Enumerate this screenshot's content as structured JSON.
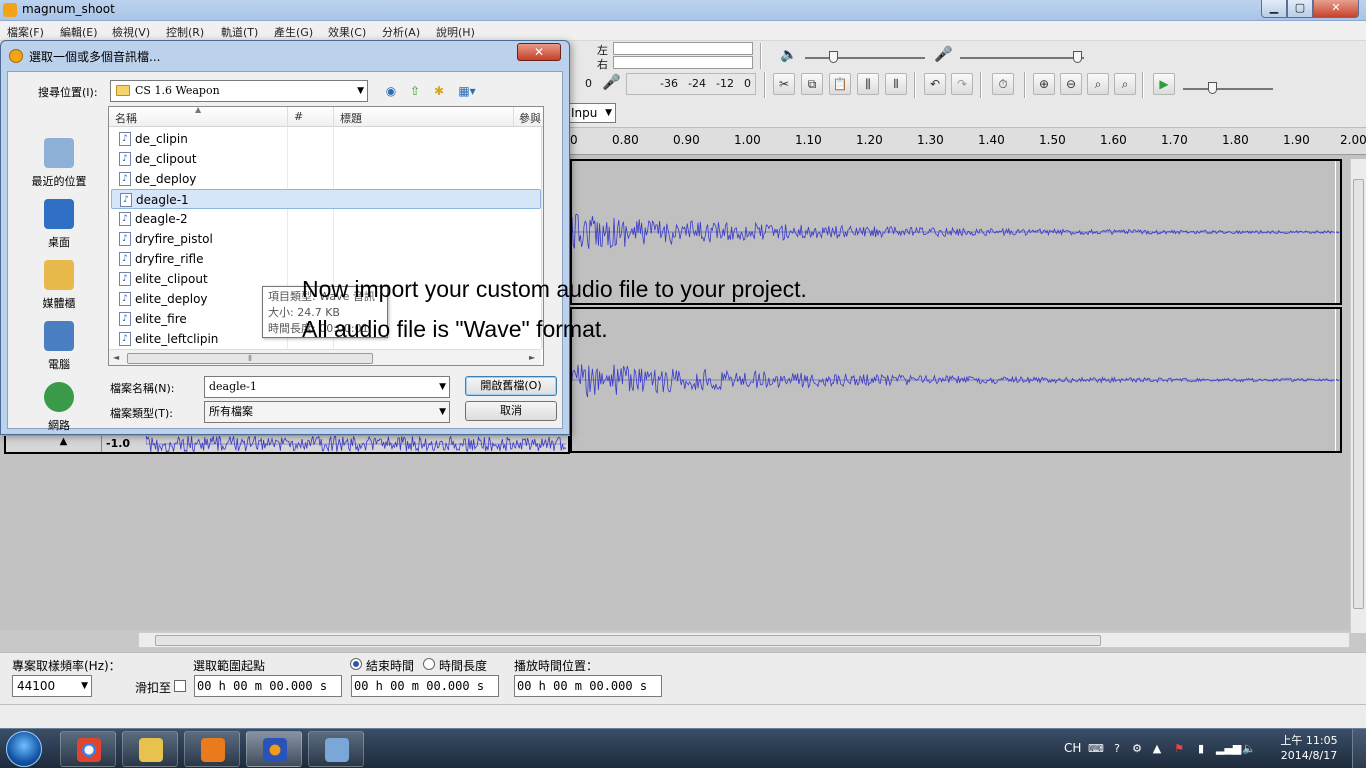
{
  "window": {
    "title": "magnum_shoot",
    "minimize": "▁",
    "maximize": "▢",
    "close": "✕"
  },
  "menu": [
    "檔案(F)",
    "編輯(E)",
    "檢視(V)",
    "控制(R)",
    "軌道(T)",
    "產生(G)",
    "效果(C)",
    "分析(A)",
    "說明(H)"
  ],
  "toolbar": {
    "channel_left": "左",
    "channel_right": "右",
    "meter_ticks": [
      "-36",
      "-24",
      "-12",
      "0"
    ],
    "input_zero": "0",
    "input_combo": "Inpu"
  },
  "ruler": {
    "labels": [
      "0",
      "0.80",
      "0.90",
      "1.00",
      "1.10",
      "1.20",
      "1.30",
      "1.40",
      "1.50",
      "1.60",
      "1.70",
      "1.80",
      "1.90",
      "2.00"
    ]
  },
  "trackpanel": {
    "collapse_arrow": "▲",
    "scale_min": "-1.0"
  },
  "selection_bar": {
    "rate_label": "專案取樣頻率(Hz)：",
    "rate_value": "44100",
    "snap_label": "滑扣至",
    "sel_start_label": "選取範圍起點",
    "end_label": "結束時間",
    "length_label": "時間長度",
    "play_pos_label": "播放時間位置：",
    "time_start": "00 h 00 m 00.000 s",
    "time_end": "00 h 00 m 00.000 s",
    "time_play": "00 h 00 m 00.000 s"
  },
  "dialog": {
    "title": "選取一個或多個音訊檔...",
    "close": "✕",
    "lookin_label": "搜尋位置(I):",
    "lookin_value": "CS 1.6 Weapon",
    "places": [
      {
        "label": "最近的位置",
        "icon": "recent-places-icon",
        "color": "#8fb0d6"
      },
      {
        "label": "桌面",
        "icon": "desktop-icon",
        "color": "#2f6fc4"
      },
      {
        "label": "媒體櫃",
        "icon": "libraries-icon",
        "color": "#e7b94a"
      },
      {
        "label": "電腦",
        "icon": "computer-icon",
        "color": "#4b7fc2"
      },
      {
        "label": "網路",
        "icon": "network-icon",
        "color": "#3b9a4a"
      }
    ],
    "columns": [
      "名稱",
      "#",
      "標題",
      "參與"
    ],
    "files": [
      "de_clipin",
      "de_clipout",
      "de_deploy",
      "deagle-1",
      "deagle-2",
      "dryfire_pistol",
      "dryfire_rifle",
      "elite_clipout",
      "elite_deploy",
      "elite_fire",
      "elite_leftclipin"
    ],
    "selected_index": 3,
    "tooltip": {
      "type": "項目類型: Wave 音訊",
      "size": "大小: 24.7 KB",
      "length": "時間長度: 00:00:01"
    },
    "filename_label": "檔案名稱(N):",
    "filename_value": "deagle-1",
    "filetype_label": "檔案類型(T):",
    "filetype_value": "所有檔案",
    "open_button": "開啟舊檔(O)",
    "cancel_button": "取消"
  },
  "annotation": {
    "line1": "Now import your custom audio file to your project.",
    "line2": "All audio file is \"Wave\" format."
  },
  "taskbar": {
    "lang": "CH",
    "time": "上午 11:05",
    "date": "2014/8/17",
    "apps": [
      {
        "name": "chrome",
        "color": "#e0442c"
      },
      {
        "name": "explorer",
        "color": "#e8c24f"
      },
      {
        "name": "media-player",
        "color": "#ea7b1c"
      },
      {
        "name": "audacity",
        "color": "#2a53b8"
      },
      {
        "name": "paint",
        "color": "#7aa7d8"
      }
    ]
  },
  "colors": {
    "waveform": "#3a3ac8",
    "accent": "#2a56b6"
  }
}
